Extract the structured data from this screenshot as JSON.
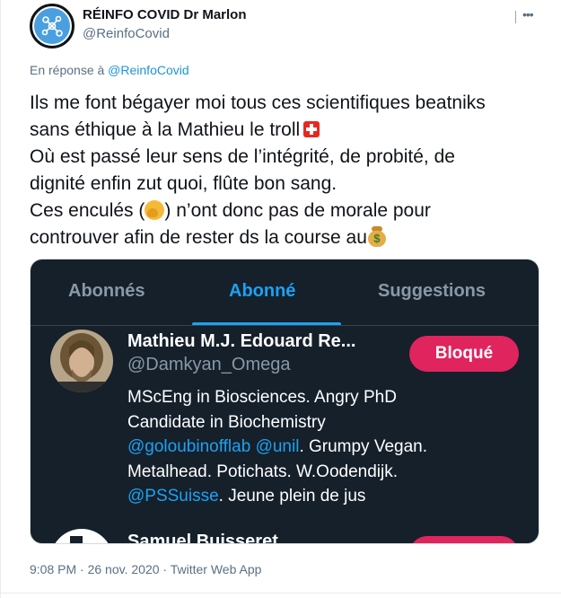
{
  "author": {
    "name": "RÉINFO COVID Dr Marlon",
    "handle": "@ReinfoCovid",
    "avatar_icon": "molecule-icon"
  },
  "more_icon": "more-options-icon",
  "reply": {
    "prefix": "En réponse à ",
    "handle": "@ReinfoCovid"
  },
  "tweet": {
    "line1": "Ils me font bégayer moi tous ces scientifiques beatniks",
    "line2": "sans éthique à la Mathieu le troll",
    "line3": "Où est passé leur sens de l’intégrité, de probité, de",
    "line4": "dignité enfin zut quoi, flûte bon sang.",
    "line5a": "Ces enculés (",
    "line5b": ") n’ont donc pas de morale pour",
    "line6": "controuver afin de rester ds la course au",
    "emojis": [
      "swiss-flag-icon",
      "face-hand-over-mouth-icon",
      "money-bag-icon"
    ]
  },
  "embedded_screenshot": {
    "tabs": [
      {
        "label": "Abonnés",
        "active": false
      },
      {
        "label": "Abonné",
        "active": true
      },
      {
        "label": "Suggestions",
        "active": false
      }
    ],
    "accent_color": "#1da1f2",
    "background_color": "#15202b",
    "user": {
      "name": "Mathieu M.J. Edouard Re...",
      "handle": "@Damkyan_Omega",
      "button_label": "Bloqué",
      "button_color": "#e0245e",
      "bio_line1": "MScEng in Biosciences. Angry PhD",
      "bio_line2": "Candidate in Biochemistry",
      "bio_mention1": "@goloubinofflab",
      "bio_mention2": "@unil",
      "bio_line3_rest": ". Grumpy Vegan.",
      "bio_line4": "Metalhead. Potichats. W.Oodendijk.",
      "bio_mention3": "@PSSuisse",
      "bio_line5_rest": ". Jeune plein de jus"
    },
    "next_user": {
      "name": "Samuel Buisseret"
    }
  },
  "footer": {
    "time": "9:08 PM",
    "separator1": " · ",
    "date": "26 nov. 2020",
    "separator2": " · ",
    "source": "Twitter Web App"
  }
}
